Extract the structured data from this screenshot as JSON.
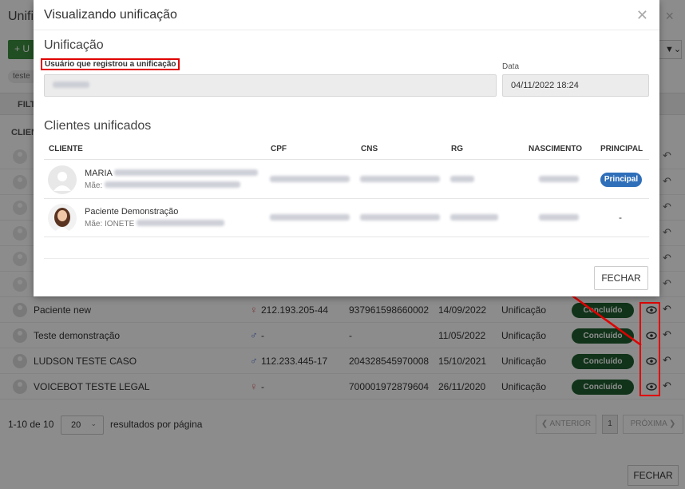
{
  "background": {
    "title": "Unifi",
    "close_icon": "×",
    "add_button_label": "+ U",
    "filter_icon": "filter-dropdown",
    "chip_label": "teste",
    "filter_bar_label": "FILT",
    "column_head": "CLIEN",
    "rows": [
      {
        "name": "Paciente new",
        "sex": "female",
        "sex_glyph": "♀",
        "cpf": "212.193.205-44",
        "cns": "937961598660002",
        "date": "14/09/2022",
        "type": "Unificação",
        "status": "Concluído"
      },
      {
        "name": "Teste demonstração",
        "sex": "male",
        "sex_glyph": "♂",
        "cpf": "-",
        "cns": "-",
        "date": "11/05/2022",
        "type": "Unificação",
        "status": "Concluído"
      },
      {
        "name": "LUDSON TESTE CASO",
        "sex": "male",
        "sex_glyph": "♂",
        "cpf": "112.233.445-17",
        "cns": "204328545970008",
        "date": "15/10/2021",
        "type": "Unificação",
        "status": "Concluído"
      },
      {
        "name": "VOICEBOT TESTE LEGAL",
        "sex": "female",
        "sex_glyph": "♀",
        "cpf": "-",
        "cns": "700001972879604",
        "date": "26/11/2020",
        "type": "Unificação",
        "status": "Concluído"
      }
    ],
    "pagination": {
      "count_text": "1-10 de 10",
      "page_size": "20",
      "per_page_text": "resultados por página",
      "prev_label": "❮ ANTERIOR",
      "current_page": "1",
      "next_label": "PRÓXIMA ❯"
    },
    "close_button_label": "FECHAR"
  },
  "modal": {
    "title": "Visualizando unificação",
    "section_unificacao": "Unificação",
    "user_label": "Usuário que registrou a unificação",
    "date_label": "Data",
    "date_value": "04/11/2022 18:24",
    "section_clientes": "Clientes unificados",
    "columns": {
      "cliente": "CLIENTE",
      "cpf": "CPF",
      "cns": "CNS",
      "rg": "RG",
      "nascimento": "NASCIMENTO",
      "principal": "PRINCIPAL"
    },
    "clients": [
      {
        "name": "MARIA",
        "mae_prefix": "Mãe:",
        "principal_badge": "Principal",
        "avatar": "placeholder-avatar"
      },
      {
        "name": "Paciente Demonstração",
        "mae_prefix": "Mãe: IONETE",
        "principal_text": "-",
        "avatar": "photo-avatar"
      }
    ],
    "close_label": "FECHAR"
  },
  "colors": {
    "status_green": "#1e5e2e",
    "principal_blue": "#2f6fba",
    "highlight_red": "#e00000",
    "add_green": "#3e8e41"
  }
}
